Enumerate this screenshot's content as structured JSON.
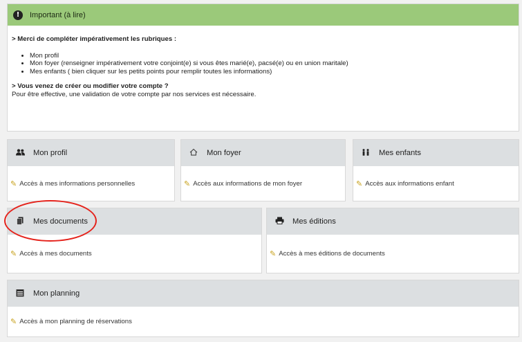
{
  "important": {
    "title": "Important (à lire)",
    "icon": "exclamation-icon",
    "line1": "> Merci de compléter impérativement les rubriques :",
    "items": [
      "Mon profil",
      "Mon foyer (renseigner impérativement votre conjoint(e) si vous êtes marié(e), pacsé(e) ou en union maritale)",
      "Mes enfants ( bien cliquer sur les petits points pour remplir toutes les informations)"
    ],
    "line2": "> Vous venez de créer ou modifier votre compte ?",
    "line3": "Pour être effective, une validation de votre compte par nos services est nécessaire."
  },
  "cards": {
    "profil": {
      "title": "Mon profil",
      "icon": "users-icon",
      "link": "Accès à mes informations personnelles"
    },
    "foyer": {
      "title": "Mon foyer",
      "icon": "home-icon",
      "link": "Accès aux informations de mon foyer"
    },
    "enfants": {
      "title": "Mes enfants",
      "icon": "children-icon",
      "link": "Accès aux informations enfant"
    },
    "docs": {
      "title": "Mes documents",
      "icon": "file-icon",
      "link": "Accès à mes documents"
    },
    "editions": {
      "title": "Mes éditions",
      "icon": "printer-icon",
      "link": "Accès à mes éditions de documents"
    },
    "planning": {
      "title": "Mon planning",
      "icon": "calendar-icon",
      "link": "Accès à mon planning de réservations"
    }
  },
  "colors": {
    "important_header": "#9bc97a",
    "card_header": "#dcdfe1",
    "pencil": "#c8a21e",
    "annotation": "#e5231c"
  }
}
